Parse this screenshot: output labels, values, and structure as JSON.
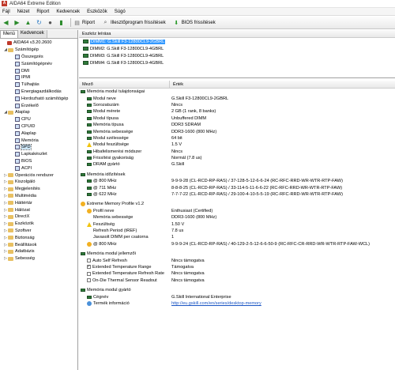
{
  "window": {
    "title": "AIDA64 Extreme Edition"
  },
  "menu": [
    "Fájl",
    "Nézet",
    "Riport",
    "Kedvencek",
    "Eszközök",
    "Súgó"
  ],
  "toolbar": {
    "report": "Riport",
    "bios_prog": "Illesztőprogram frissítések",
    "bios_update": "BIOS frissítések"
  },
  "left_tabs": [
    "Menü",
    "Kedvencek"
  ],
  "tree": [
    {
      "label": "AIDA64 v3.20.2600",
      "level": 0
    },
    {
      "label": "Számítógép",
      "level": 1
    },
    {
      "label": "Összegzés",
      "level": 2
    },
    {
      "label": "Számítógépnév",
      "level": 2
    },
    {
      "label": "DMI",
      "level": 2
    },
    {
      "label": "IPMI",
      "level": 2
    },
    {
      "label": "Túlhajtás",
      "level": 2
    },
    {
      "label": "Energiagazdálkodás",
      "level": 2
    },
    {
      "label": "Hordozható számítógép",
      "level": 2
    },
    {
      "label": "Érzékelő",
      "level": 2
    },
    {
      "label": "Alaplap",
      "level": 1
    },
    {
      "label": "CPU",
      "level": 2
    },
    {
      "label": "CPUID",
      "level": 2
    },
    {
      "label": "Alaplap",
      "level": 2
    },
    {
      "label": "Memória",
      "level": 2
    },
    {
      "label": "SPD",
      "level": 2
    },
    {
      "label": "Lapkakészlet",
      "level": 2
    },
    {
      "label": "BIOS",
      "level": 2
    },
    {
      "label": "ACPI",
      "level": 2
    },
    {
      "label": "Operációs rendszer",
      "level": 1
    },
    {
      "label": "Kiszolgáló",
      "level": 1
    },
    {
      "label": "Megjelenítés",
      "level": 1
    },
    {
      "label": "Multimédia",
      "level": 1
    },
    {
      "label": "Háttértár",
      "level": 1
    },
    {
      "label": "Hálózat",
      "level": 1
    },
    {
      "label": "DirectX",
      "level": 1
    },
    {
      "label": "Eszközök",
      "level": 1
    },
    {
      "label": "Szoftver",
      "level": 1
    },
    {
      "label": "Biztonság",
      "level": 1
    },
    {
      "label": "Beállítások",
      "level": 1
    },
    {
      "label": "Adatbázis",
      "level": 1
    },
    {
      "label": "Sebesség",
      "level": 1
    }
  ],
  "device_list": {
    "header": "Eszköz leírása",
    "items": [
      "DIMM1: G.Skill F3-12800CL9-2GBRL",
      "DIMM2: G.Skill F3-12800CL9-4GBRL",
      "DIMM3: G.Skill F3-12800CL9-4GBRL",
      "DIMM4: G.Skill F3-12800CL9-4GBRL"
    ]
  },
  "details": {
    "col_field": "Mező",
    "col_value": "Érték",
    "sections": [
      {
        "title": "Memória modul tulajdonságai",
        "rows": [
          {
            "field": "Modul neve",
            "value": "G.Skill F3-12800CL9-2GBRL"
          },
          {
            "field": "Sorozatszám",
            "value": "Nincs"
          },
          {
            "field": "Modul mérete",
            "value": "2 GB (1 rank, 8 banks)"
          },
          {
            "field": "Modul típusa",
            "value": "Unbuffered DIMM"
          },
          {
            "field": "Memória típusa",
            "value": "DDR3 SDRAM"
          },
          {
            "field": "Memória sebessége",
            "value": "DDR3-1600 (800 MHz)"
          },
          {
            "field": "Modul szélessége",
            "value": "64 bit"
          },
          {
            "field": "Modul feszültsége",
            "value": "1.5 V"
          },
          {
            "field": "Hibafelismerési módszer",
            "value": "Nincs"
          },
          {
            "field": "Frissítési gyakoriság",
            "value": "Normál (7.8 us)"
          },
          {
            "field": "DRAM gyártó",
            "value": "G.Skill"
          }
        ]
      },
      {
        "title": "Memória időzítések",
        "rows": [
          {
            "field": "@ 800 MHz",
            "value": "9-9-9-28  (CL-RCD-RP-RAS) / 37-128-5-12-6-6-24  (RC-RFC-RRD-WR-WTR-RTP-FAW)"
          },
          {
            "field": "@ 711 MHz",
            "value": "8-8-8-25  (CL-RCD-RP-RAS) / 33-114-5-11-6-6-22  (RC-RFC-RRD-WR-WTR-RTP-FAW)"
          },
          {
            "field": "@ 622 MHz",
            "value": "7-7-7-22  (CL-RCD-RP-RAS) / 29-100-4-10-5-5-19  (RC-RFC-RRD-WR-WTR-RTP-FAW)"
          }
        ]
      },
      {
        "title": "Extreme Memory Profile v1.2",
        "rows": [
          {
            "field": "Profil neve",
            "value": "Enthusiast (Certified)"
          },
          {
            "field": "Memória sebessége",
            "value": "DDR3-1600 (800 MHz)"
          },
          {
            "field": "Feszültség",
            "value": "1.50 V"
          },
          {
            "field": "Refresh Period (tREF)",
            "value": "7.8 us"
          },
          {
            "field": "Javasolt DIMM per csatorna",
            "value": "1"
          },
          {
            "field": "@ 800 MHz",
            "value": "9-9-9-24  (CL-RCD-RP-RAS) / 40-129-2-5-12-6-6-50-9  (RC-RFC-CR-RRD-WR-WTR-RTP-FAW-WCL)"
          }
        ]
      },
      {
        "title": "Memória modul jellemzői",
        "rows": [
          {
            "field": "Auto Self Refresh",
            "value": "Nincs támogatva",
            "checked": false
          },
          {
            "field": "Extended Temperature Range",
            "value": "Támogatva",
            "checked": true
          },
          {
            "field": "Extended Temperature Refresh Rate",
            "value": "Nincs támogatva",
            "checked": false
          },
          {
            "field": "On-Die Thermal Sensor Readout",
            "value": "Nincs támogatva",
            "checked": false
          }
        ]
      },
      {
        "title": "Memória modul gyártó",
        "rows": [
          {
            "field": "Cégnév",
            "value": "G.Skill International Enterprise"
          },
          {
            "field": "Termék információ",
            "value": "http://eu.gskill.com/en/series/desktop-memory"
          }
        ]
      }
    ]
  },
  "colors": {
    "selection": "#3399ff",
    "link": "#1a55c4",
    "tree_selected": "#cde6f7"
  }
}
